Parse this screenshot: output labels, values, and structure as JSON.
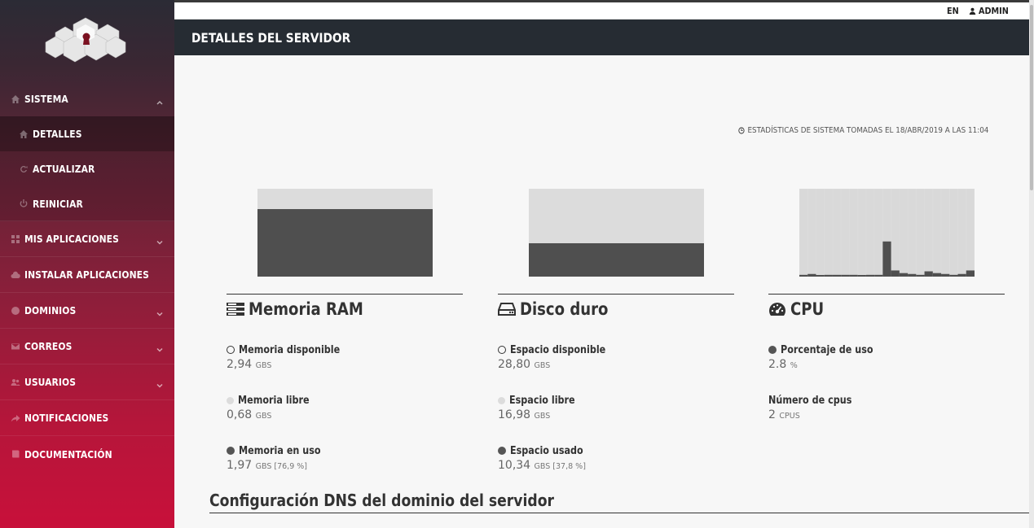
{
  "topbar": {
    "lang": "EN",
    "user": "ADMIN"
  },
  "header": {
    "title": "DETALLES DEL SERVIDOR"
  },
  "sidebar": {
    "items": [
      {
        "label": "SISTEMA",
        "icon": "home-icon",
        "expanded": true
      },
      {
        "label": "DETALLES",
        "icon": "home-icon",
        "active": true
      },
      {
        "label": "ACTUALIZAR",
        "icon": "refresh-icon"
      },
      {
        "label": "REINICIAR",
        "icon": "power-icon"
      },
      {
        "label": "MIS APLICACIONES",
        "icon": "grid-icon"
      },
      {
        "label": "INSTALAR APLICACIONES",
        "icon": "cloud-icon"
      },
      {
        "label": "DOMINIOS",
        "icon": "globe-icon"
      },
      {
        "label": "CORREOS",
        "icon": "envelope-icon"
      },
      {
        "label": "USUARIOS",
        "icon": "users-icon"
      },
      {
        "label": "NOTIFICACIONES",
        "icon": "share-icon"
      },
      {
        "label": "DOCUMENTACIÓN",
        "icon": "book-icon"
      }
    ]
  },
  "stats_note": "ESTADÍSTICAS DE SISTEMA TOMADAS EL 18/ABR/2019 A LAS 11:04",
  "ram": {
    "title": "Memoria RAM",
    "used_fraction": 0.769,
    "available_label": "Memoria disponible",
    "available_value": "2,94",
    "available_unit": "GBS",
    "free_label": "Memoria libre",
    "free_value": "0,68",
    "free_unit": "GBS",
    "used_label": "Memoria en uso",
    "used_value": "1,97",
    "used_unit": "GBS [76,9 %]"
  },
  "disk": {
    "title": "Disco duro",
    "used_fraction": 0.378,
    "available_label": "Espacio disponible",
    "available_value": "28,80",
    "available_unit": "GBS",
    "free_label": "Espacio libre",
    "free_value": "16,98",
    "free_unit": "GBS",
    "used_label": "Espacio usado",
    "used_value": "10,34",
    "used_unit": "GBS [37,8 %]"
  },
  "cpu": {
    "title": "CPU",
    "usage_label": "Porcentaje de uso",
    "usage_value": "2.8",
    "usage_unit": "%",
    "count_label": "Número de cpus",
    "count_value": "2",
    "count_unit": "CPUS",
    "history_percent": [
      2,
      3,
      1,
      2,
      2,
      2,
      2,
      1,
      2,
      2,
      40,
      7,
      4,
      3,
      2,
      6,
      4,
      3,
      2,
      3,
      7
    ]
  },
  "dns": {
    "title": "Configuración DNS del dominio del servidor"
  },
  "colors": {
    "header_bg": "#262c33",
    "sidebar_bottom": "#c8103a",
    "chart_used": "#4f4f4f",
    "chart_free": "#dcdcdc"
  }
}
